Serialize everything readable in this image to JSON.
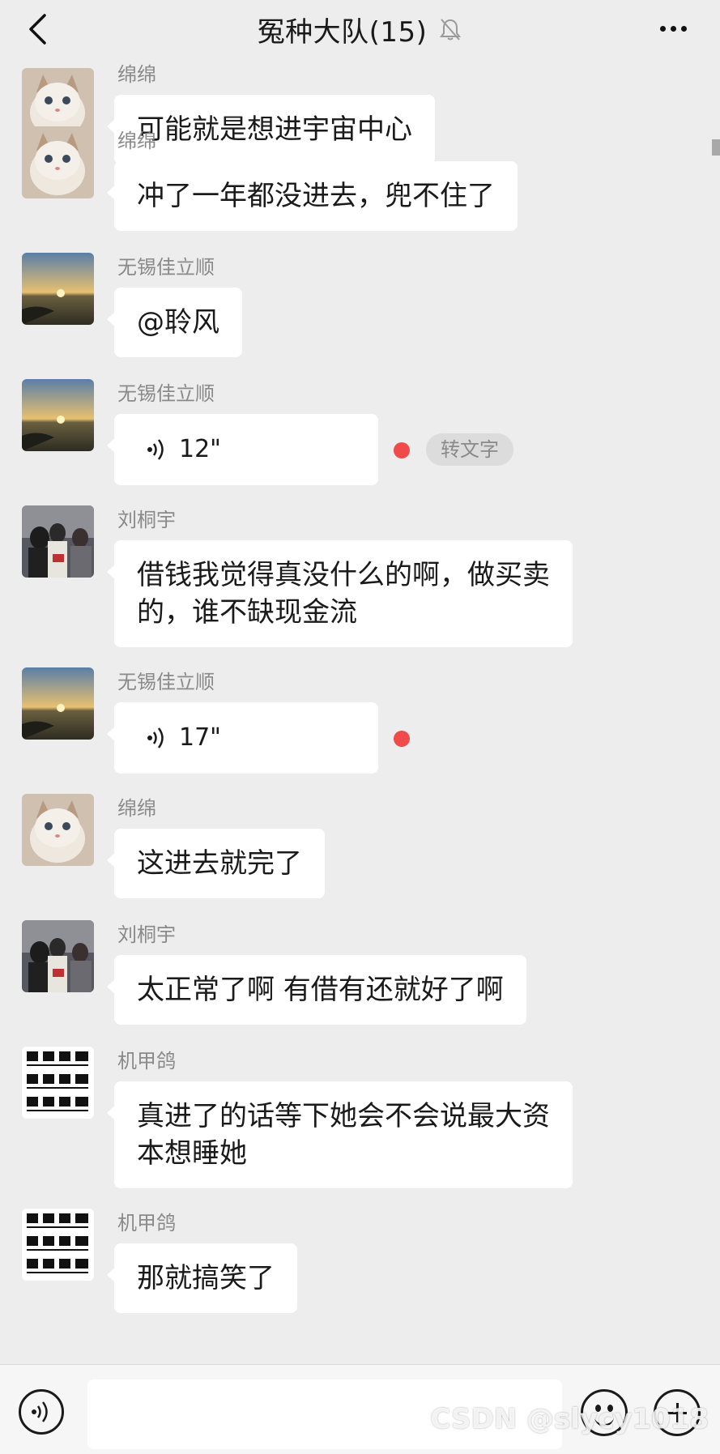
{
  "header": {
    "title": "冤种大队(15)",
    "back_icon": "chevron-left-icon",
    "mute_icon": "bell-off-icon",
    "more_icon": "more-dots-icon"
  },
  "messages": [
    {
      "sender": "绵绵",
      "avatar": "kitten",
      "type": "text",
      "text": "可能就是想进宇宙中心"
    },
    {
      "sender": "绵绵",
      "avatar": "kitten",
      "type": "text",
      "text": "冲了一年都没进去，兜不住了"
    },
    {
      "sender": "无锡佳立顺",
      "avatar": "sunset",
      "type": "text",
      "text": "@聆风"
    },
    {
      "sender": "无锡佳立顺",
      "avatar": "sunset",
      "type": "voice",
      "duration": "12\"",
      "unread": true,
      "convert_label": "转文字"
    },
    {
      "sender": "刘桐宇",
      "avatar": "group-photo",
      "type": "text",
      "text": "借钱我觉得真没什么的啊，做买卖\n的，谁不缺现金流"
    },
    {
      "sender": "无锡佳立顺",
      "avatar": "sunset",
      "type": "voice",
      "duration": "17\"",
      "unread": true
    },
    {
      "sender": "绵绵",
      "avatar": "kitten",
      "type": "text",
      "text": "这进去就完了"
    },
    {
      "sender": "刘桐宇",
      "avatar": "group-photo",
      "type": "text",
      "text": "太正常了啊 有借有还就好了啊"
    },
    {
      "sender": "机甲鸽",
      "avatar": "laundry-icons",
      "type": "text",
      "text": "真进了的话等下她会不会说最大资\n本想睡她"
    },
    {
      "sender": "机甲鸽",
      "avatar": "laundry-icons",
      "type": "text",
      "text": "那就搞笑了"
    }
  ],
  "input": {
    "value": "",
    "placeholder": ""
  },
  "footer": {
    "voice_icon": "voice-icon",
    "emoji_icon": "emoji-icon",
    "plus_icon": "plus-icon"
  },
  "watermark": "CSDN @slycy1018",
  "colors": {
    "background": "#ededed",
    "bubble": "#ffffff",
    "unread_dot": "#f04b4b",
    "name_text": "#8a8a8a"
  }
}
